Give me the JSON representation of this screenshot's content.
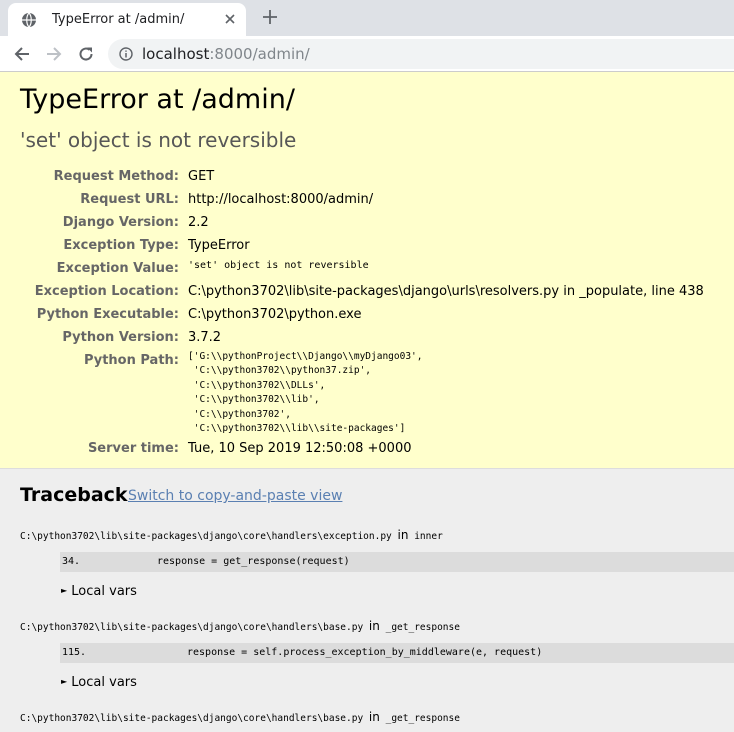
{
  "browser": {
    "tab_title": "TypeError at /admin/",
    "url_host": "localhost",
    "url_rest": ":8000/admin/"
  },
  "error": {
    "title": "TypeError at /admin/",
    "subtitle": "'set' object is not reversible"
  },
  "meta": [
    {
      "label": "Request Method:",
      "value": "GET"
    },
    {
      "label": "Request URL:",
      "value": "http://localhost:8000/admin/"
    },
    {
      "label": "Django Version:",
      "value": "2.2"
    },
    {
      "label": "Exception Type:",
      "value": "TypeError"
    },
    {
      "label": "Exception Value:",
      "value": "'set' object is not reversible"
    },
    {
      "label": "Exception Location:",
      "value": "C:\\python3702\\lib\\site-packages\\django\\urls\\resolvers.py in _populate, line 438"
    },
    {
      "label": "Python Executable:",
      "value": "C:\\python3702\\python.exe"
    },
    {
      "label": "Python Version:",
      "value": "3.7.2"
    },
    {
      "label": "Python Path:",
      "value": "['G:\\\\pythonProject\\\\Django\\\\myDjango03',\n 'C:\\\\python3702\\\\python37.zip',\n 'C:\\\\python3702\\\\DLLs',\n 'C:\\\\python3702\\\\lib',\n 'C:\\\\python3702',\n 'C:\\\\python3702\\\\lib\\\\site-packages']"
    },
    {
      "label": "Server time:",
      "value": "Tue, 10 Sep 2019 12:50:08 +0000"
    }
  ],
  "traceback": {
    "title": "Traceback",
    "switch_link": "Switch to copy-and-paste view",
    "in_word": "in",
    "local_vars": "Local vars",
    "frames": [
      {
        "file": "C:\\python3702\\lib\\site-packages\\django\\core\\handlers\\exception.py",
        "func": "inner",
        "line_no": "34.",
        "code": "response = get_response(request)"
      },
      {
        "file": "C:\\python3702\\lib\\site-packages\\django\\core\\handlers\\base.py",
        "func": "_get_response",
        "line_no": "115.",
        "code": "response = self.process_exception_by_middleware(e, request)"
      },
      {
        "file": "C:\\python3702\\lib\\site-packages\\django\\core\\handlers\\base.py",
        "func": "_get_response"
      }
    ]
  }
}
